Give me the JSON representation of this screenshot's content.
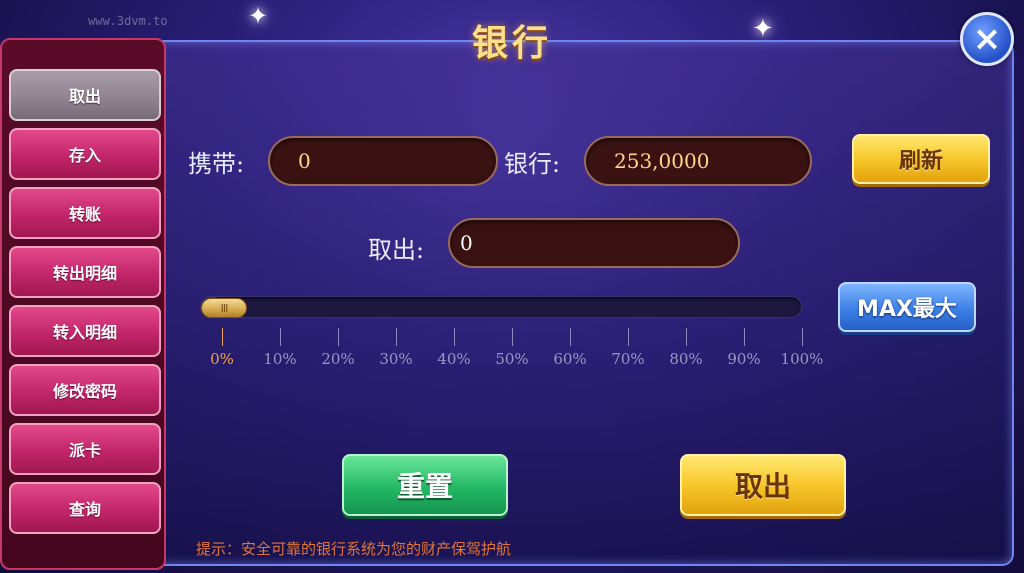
{
  "watermark": "www.3dvm.to",
  "title": "银行",
  "close_icon": "×",
  "sidebar": {
    "items": [
      {
        "label": "取出",
        "active": true
      },
      {
        "label": "存入"
      },
      {
        "label": "转账"
      },
      {
        "label": "转出明细"
      },
      {
        "label": "转入明细"
      },
      {
        "label": "修改密码"
      },
      {
        "label": "派卡"
      },
      {
        "label": "查询"
      }
    ]
  },
  "form": {
    "carry_label": "携带:",
    "carry_value": "0",
    "bank_label": "银行:",
    "bank_value": "253,0000",
    "refresh_label": "刷新",
    "withdraw_label": "取出:",
    "withdraw_value": "0",
    "max_label": "MAX最大"
  },
  "slider": {
    "value_percent": 0,
    "thumb_grip": "III",
    "ticks": [
      "0%",
      "10%",
      "20%",
      "30%",
      "40%",
      "50%",
      "60%",
      "70%",
      "80%",
      "90%",
      "100%"
    ]
  },
  "actions": {
    "reset_label": "重置",
    "withdraw_label": "取出"
  },
  "hint": "提示：安全可靠的银行系统为您的财产保驾护航",
  "colors": {
    "accent_gold": "#f7c72a",
    "accent_green": "#23b865",
    "accent_blue": "#3d80e6",
    "sidebar_pink": "#c2256a",
    "tick_active": "#f2a34a"
  }
}
